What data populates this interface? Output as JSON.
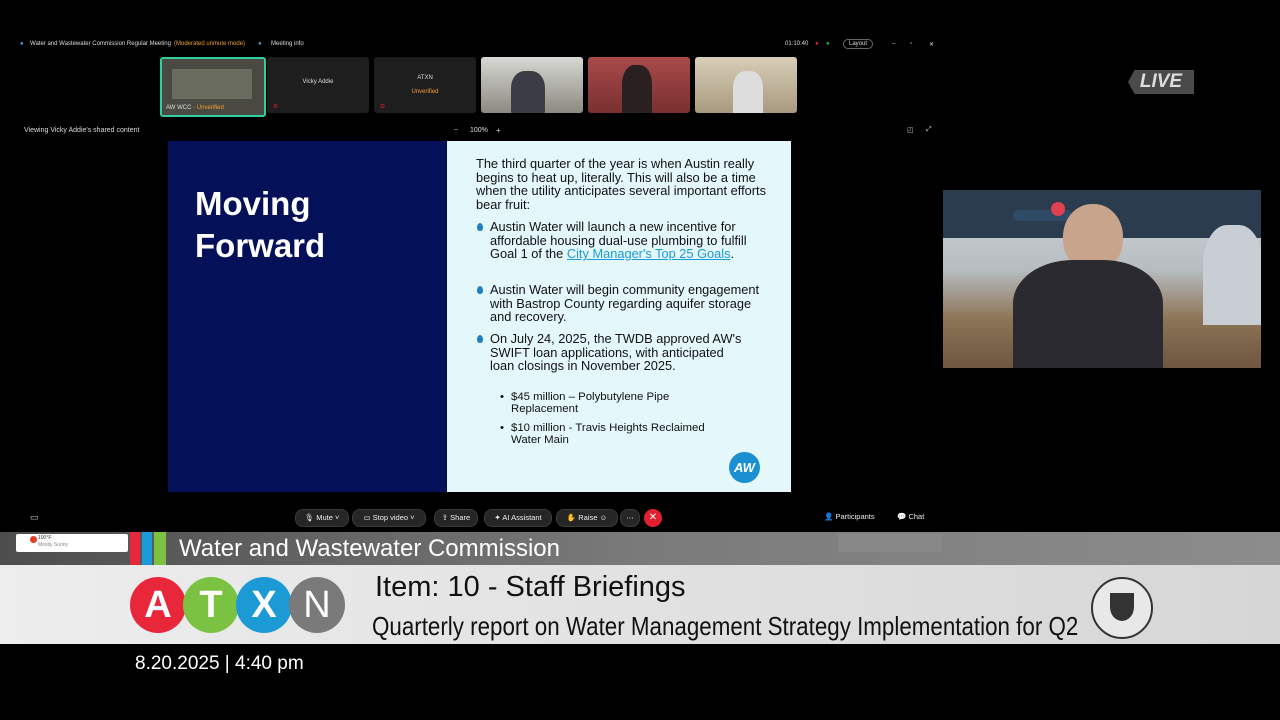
{
  "meeting": {
    "title": "Water and Wastewater Commission Regular Meeting",
    "mode": "(Moderated unmute mode)",
    "info_label": "Meeting info",
    "timer": "01:10:40",
    "layout_label": "Layout"
  },
  "participants": [
    {
      "label": "AW WCC",
      "status": "Unverified"
    },
    {
      "label": "Vicky Addie",
      "status": ""
    },
    {
      "label": "ATXN",
      "status": "Unverified"
    },
    {
      "label": "",
      "status": ""
    },
    {
      "label": "",
      "status": ""
    },
    {
      "label": "",
      "status": ""
    }
  ],
  "viewing_label": "Viewing Vicky Addie's shared content",
  "zoom_level": "100%",
  "live_label": "LIVE",
  "slide": {
    "title_line1": "Moving",
    "title_line2": "Forward",
    "intro": "The third quarter of the year is when Austin really begins to heat up, literally. This will also be a time when the utility anticipates several important efforts bear fruit:",
    "bullet1_text": "Austin Water will launch a new incentive for affordable housing dual-use plumbing to fulfill Goal 1 of the ",
    "bullet1_link": "City Manager's Top 25 Goals",
    "bullet1_end": ".",
    "bullet2": "Austin Water will begin community engagement with Bastrop County regarding aquifer storage and recovery.",
    "bullet3": "On July 24, 2025, the TWDB approved AW's SWIFT loan applications, with anticipated loan closings in November 2025.",
    "sub1": "$45 million – Polybutylene Pipe Replacement",
    "sub2": "$10 million - Travis Heights Reclaimed Water Main",
    "logo_text": "AW"
  },
  "controls": {
    "mute": "Mute",
    "stop_video": "Stop video",
    "share": "Share",
    "ai_assistant": "AI Assistant",
    "raise": "Raise",
    "participants": "Participants",
    "chat": "Chat"
  },
  "toast": {
    "line1": "100°F",
    "line2": "Mostly Sunny"
  },
  "lower_third": {
    "commission": "Water and Wastewater Commission",
    "logo_letters": [
      "A",
      "T",
      "X",
      "N"
    ],
    "logo_colors": [
      "#e8283a",
      "#7cc242",
      "#1c9ad6",
      "#7a7a7a"
    ],
    "item_title": "Item: 10 - Staff Briefings",
    "item_subtitle": "Quarterly report on Water Management Strategy Implementation for Q2",
    "datetime": "8.20.2025 | 4:40 pm"
  }
}
